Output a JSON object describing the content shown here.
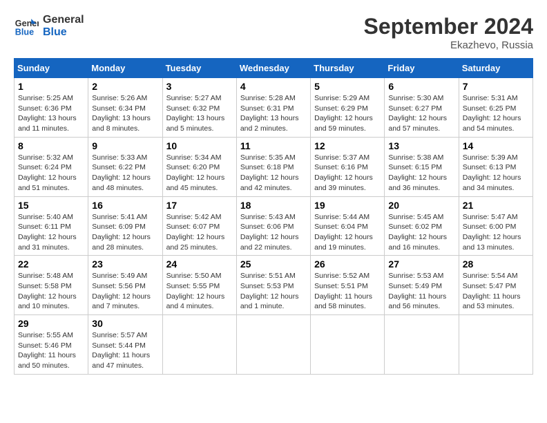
{
  "header": {
    "logo_line1": "General",
    "logo_line2": "Blue",
    "month": "September 2024",
    "location": "Ekazhevo, Russia"
  },
  "weekdays": [
    "Sunday",
    "Monday",
    "Tuesday",
    "Wednesday",
    "Thursday",
    "Friday",
    "Saturday"
  ],
  "weeks": [
    [
      {
        "day": "1",
        "info": "Sunrise: 5:25 AM\nSunset: 6:36 PM\nDaylight: 13 hours\nand 11 minutes."
      },
      {
        "day": "2",
        "info": "Sunrise: 5:26 AM\nSunset: 6:34 PM\nDaylight: 13 hours\nand 8 minutes."
      },
      {
        "day": "3",
        "info": "Sunrise: 5:27 AM\nSunset: 6:32 PM\nDaylight: 13 hours\nand 5 minutes."
      },
      {
        "day": "4",
        "info": "Sunrise: 5:28 AM\nSunset: 6:31 PM\nDaylight: 13 hours\nand 2 minutes."
      },
      {
        "day": "5",
        "info": "Sunrise: 5:29 AM\nSunset: 6:29 PM\nDaylight: 12 hours\nand 59 minutes."
      },
      {
        "day": "6",
        "info": "Sunrise: 5:30 AM\nSunset: 6:27 PM\nDaylight: 12 hours\nand 57 minutes."
      },
      {
        "day": "7",
        "info": "Sunrise: 5:31 AM\nSunset: 6:25 PM\nDaylight: 12 hours\nand 54 minutes."
      }
    ],
    [
      {
        "day": "8",
        "info": "Sunrise: 5:32 AM\nSunset: 6:24 PM\nDaylight: 12 hours\nand 51 minutes."
      },
      {
        "day": "9",
        "info": "Sunrise: 5:33 AM\nSunset: 6:22 PM\nDaylight: 12 hours\nand 48 minutes."
      },
      {
        "day": "10",
        "info": "Sunrise: 5:34 AM\nSunset: 6:20 PM\nDaylight: 12 hours\nand 45 minutes."
      },
      {
        "day": "11",
        "info": "Sunrise: 5:35 AM\nSunset: 6:18 PM\nDaylight: 12 hours\nand 42 minutes."
      },
      {
        "day": "12",
        "info": "Sunrise: 5:37 AM\nSunset: 6:16 PM\nDaylight: 12 hours\nand 39 minutes."
      },
      {
        "day": "13",
        "info": "Sunrise: 5:38 AM\nSunset: 6:15 PM\nDaylight: 12 hours\nand 36 minutes."
      },
      {
        "day": "14",
        "info": "Sunrise: 5:39 AM\nSunset: 6:13 PM\nDaylight: 12 hours\nand 34 minutes."
      }
    ],
    [
      {
        "day": "15",
        "info": "Sunrise: 5:40 AM\nSunset: 6:11 PM\nDaylight: 12 hours\nand 31 minutes."
      },
      {
        "day": "16",
        "info": "Sunrise: 5:41 AM\nSunset: 6:09 PM\nDaylight: 12 hours\nand 28 minutes."
      },
      {
        "day": "17",
        "info": "Sunrise: 5:42 AM\nSunset: 6:07 PM\nDaylight: 12 hours\nand 25 minutes."
      },
      {
        "day": "18",
        "info": "Sunrise: 5:43 AM\nSunset: 6:06 PM\nDaylight: 12 hours\nand 22 minutes."
      },
      {
        "day": "19",
        "info": "Sunrise: 5:44 AM\nSunset: 6:04 PM\nDaylight: 12 hours\nand 19 minutes."
      },
      {
        "day": "20",
        "info": "Sunrise: 5:45 AM\nSunset: 6:02 PM\nDaylight: 12 hours\nand 16 minutes."
      },
      {
        "day": "21",
        "info": "Sunrise: 5:47 AM\nSunset: 6:00 PM\nDaylight: 12 hours\nand 13 minutes."
      }
    ],
    [
      {
        "day": "22",
        "info": "Sunrise: 5:48 AM\nSunset: 5:58 PM\nDaylight: 12 hours\nand 10 minutes."
      },
      {
        "day": "23",
        "info": "Sunrise: 5:49 AM\nSunset: 5:56 PM\nDaylight: 12 hours\nand 7 minutes."
      },
      {
        "day": "24",
        "info": "Sunrise: 5:50 AM\nSunset: 5:55 PM\nDaylight: 12 hours\nand 4 minutes."
      },
      {
        "day": "25",
        "info": "Sunrise: 5:51 AM\nSunset: 5:53 PM\nDaylight: 12 hours\nand 1 minute."
      },
      {
        "day": "26",
        "info": "Sunrise: 5:52 AM\nSunset: 5:51 PM\nDaylight: 11 hours\nand 58 minutes."
      },
      {
        "day": "27",
        "info": "Sunrise: 5:53 AM\nSunset: 5:49 PM\nDaylight: 11 hours\nand 56 minutes."
      },
      {
        "day": "28",
        "info": "Sunrise: 5:54 AM\nSunset: 5:47 PM\nDaylight: 11 hours\nand 53 minutes."
      }
    ],
    [
      {
        "day": "29",
        "info": "Sunrise: 5:55 AM\nSunset: 5:46 PM\nDaylight: 11 hours\nand 50 minutes."
      },
      {
        "day": "30",
        "info": "Sunrise: 5:57 AM\nSunset: 5:44 PM\nDaylight: 11 hours\nand 47 minutes."
      },
      {
        "day": "",
        "info": ""
      },
      {
        "day": "",
        "info": ""
      },
      {
        "day": "",
        "info": ""
      },
      {
        "day": "",
        "info": ""
      },
      {
        "day": "",
        "info": ""
      }
    ]
  ]
}
